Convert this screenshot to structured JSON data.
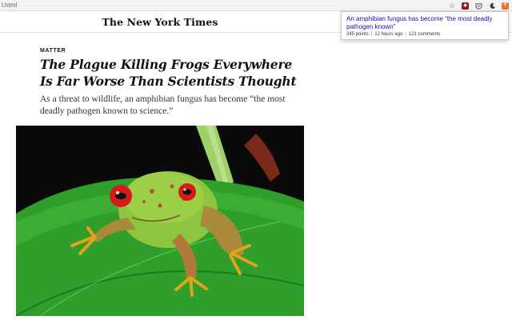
{
  "browser": {
    "url": "l.html",
    "toolbar_icons": [
      "star-icon",
      "extension-icon",
      "pocket-icon",
      "dark-mode-icon",
      "hn-extension-icon"
    ]
  },
  "masthead": {
    "logo": "The New York Times"
  },
  "hn_popup": {
    "title": "An amphibian fungus has become “the most deadly pathogen known”",
    "points": "245 points",
    "time": "12 hours ago",
    "comments": "121 comments"
  },
  "article": {
    "kicker": "MATTER",
    "headline_line1": "The Plague Killing Frogs Everywhere",
    "headline_line2": "Is Far Worse Than Scientists Thought",
    "deck": "As a threat to wildlife, an amphibian fungus has become “the most deadly pathogen known to science.”"
  },
  "colors": {
    "link": "#1a0dab",
    "leaf_green": "#2f9e2a",
    "frog_green": "#8cc63e",
    "frog_eye": "#d51c1c"
  }
}
